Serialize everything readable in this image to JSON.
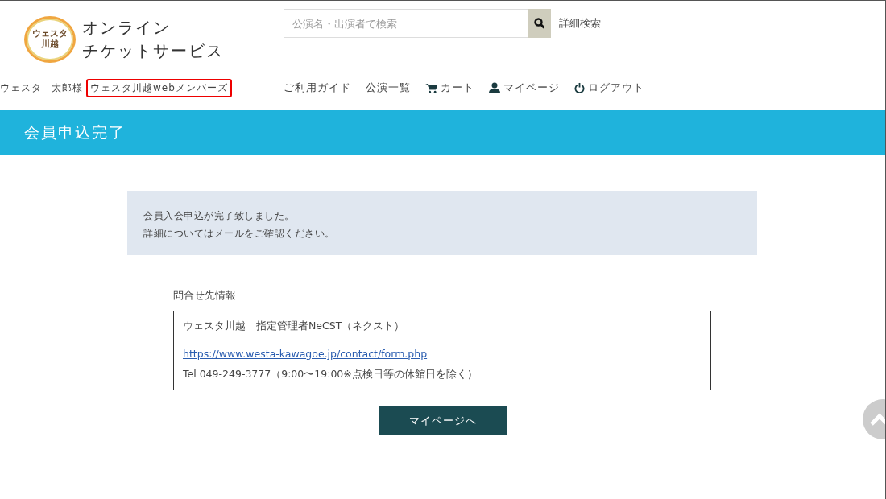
{
  "logo": {
    "line_1": "ウェスタ",
    "line_2": "川越"
  },
  "site_title": {
    "line_1": "オンライン",
    "line_2": "チケットサービス"
  },
  "search": {
    "placeholder": "公演名・出演者で検索",
    "advanced_link": "詳細検索"
  },
  "user": {
    "name_parts": [
      "ウェスタ",
      "太郎様"
    ],
    "member_type": "ウェスタ川越webメンバーズ",
    "highlighted": true
  },
  "nav": [
    {
      "kind": "text",
      "label": "ご利用ガイド"
    },
    {
      "kind": "text",
      "label": "公演一覧"
    },
    {
      "kind": "cart",
      "label": "カート"
    },
    {
      "kind": "user",
      "label": "マイページ"
    },
    {
      "kind": "power",
      "label": "ログアウト"
    }
  ],
  "page_title": "会員申込完了",
  "message": [
    "会員入会申込が完了致しました。",
    "詳細についてはメールをご確認ください。"
  ],
  "contact": {
    "label": "問合せ先情報",
    "name": "ウェスタ川越　指定管理者NeCST（ネクスト）",
    "url": "https://www.westa-kawagoe.jp/contact/form.php",
    "tel": "Tel 049-249-3777（9:00〜19:00※点検日等の休館日を除く）"
  },
  "mypage_button": "マイページへ"
}
